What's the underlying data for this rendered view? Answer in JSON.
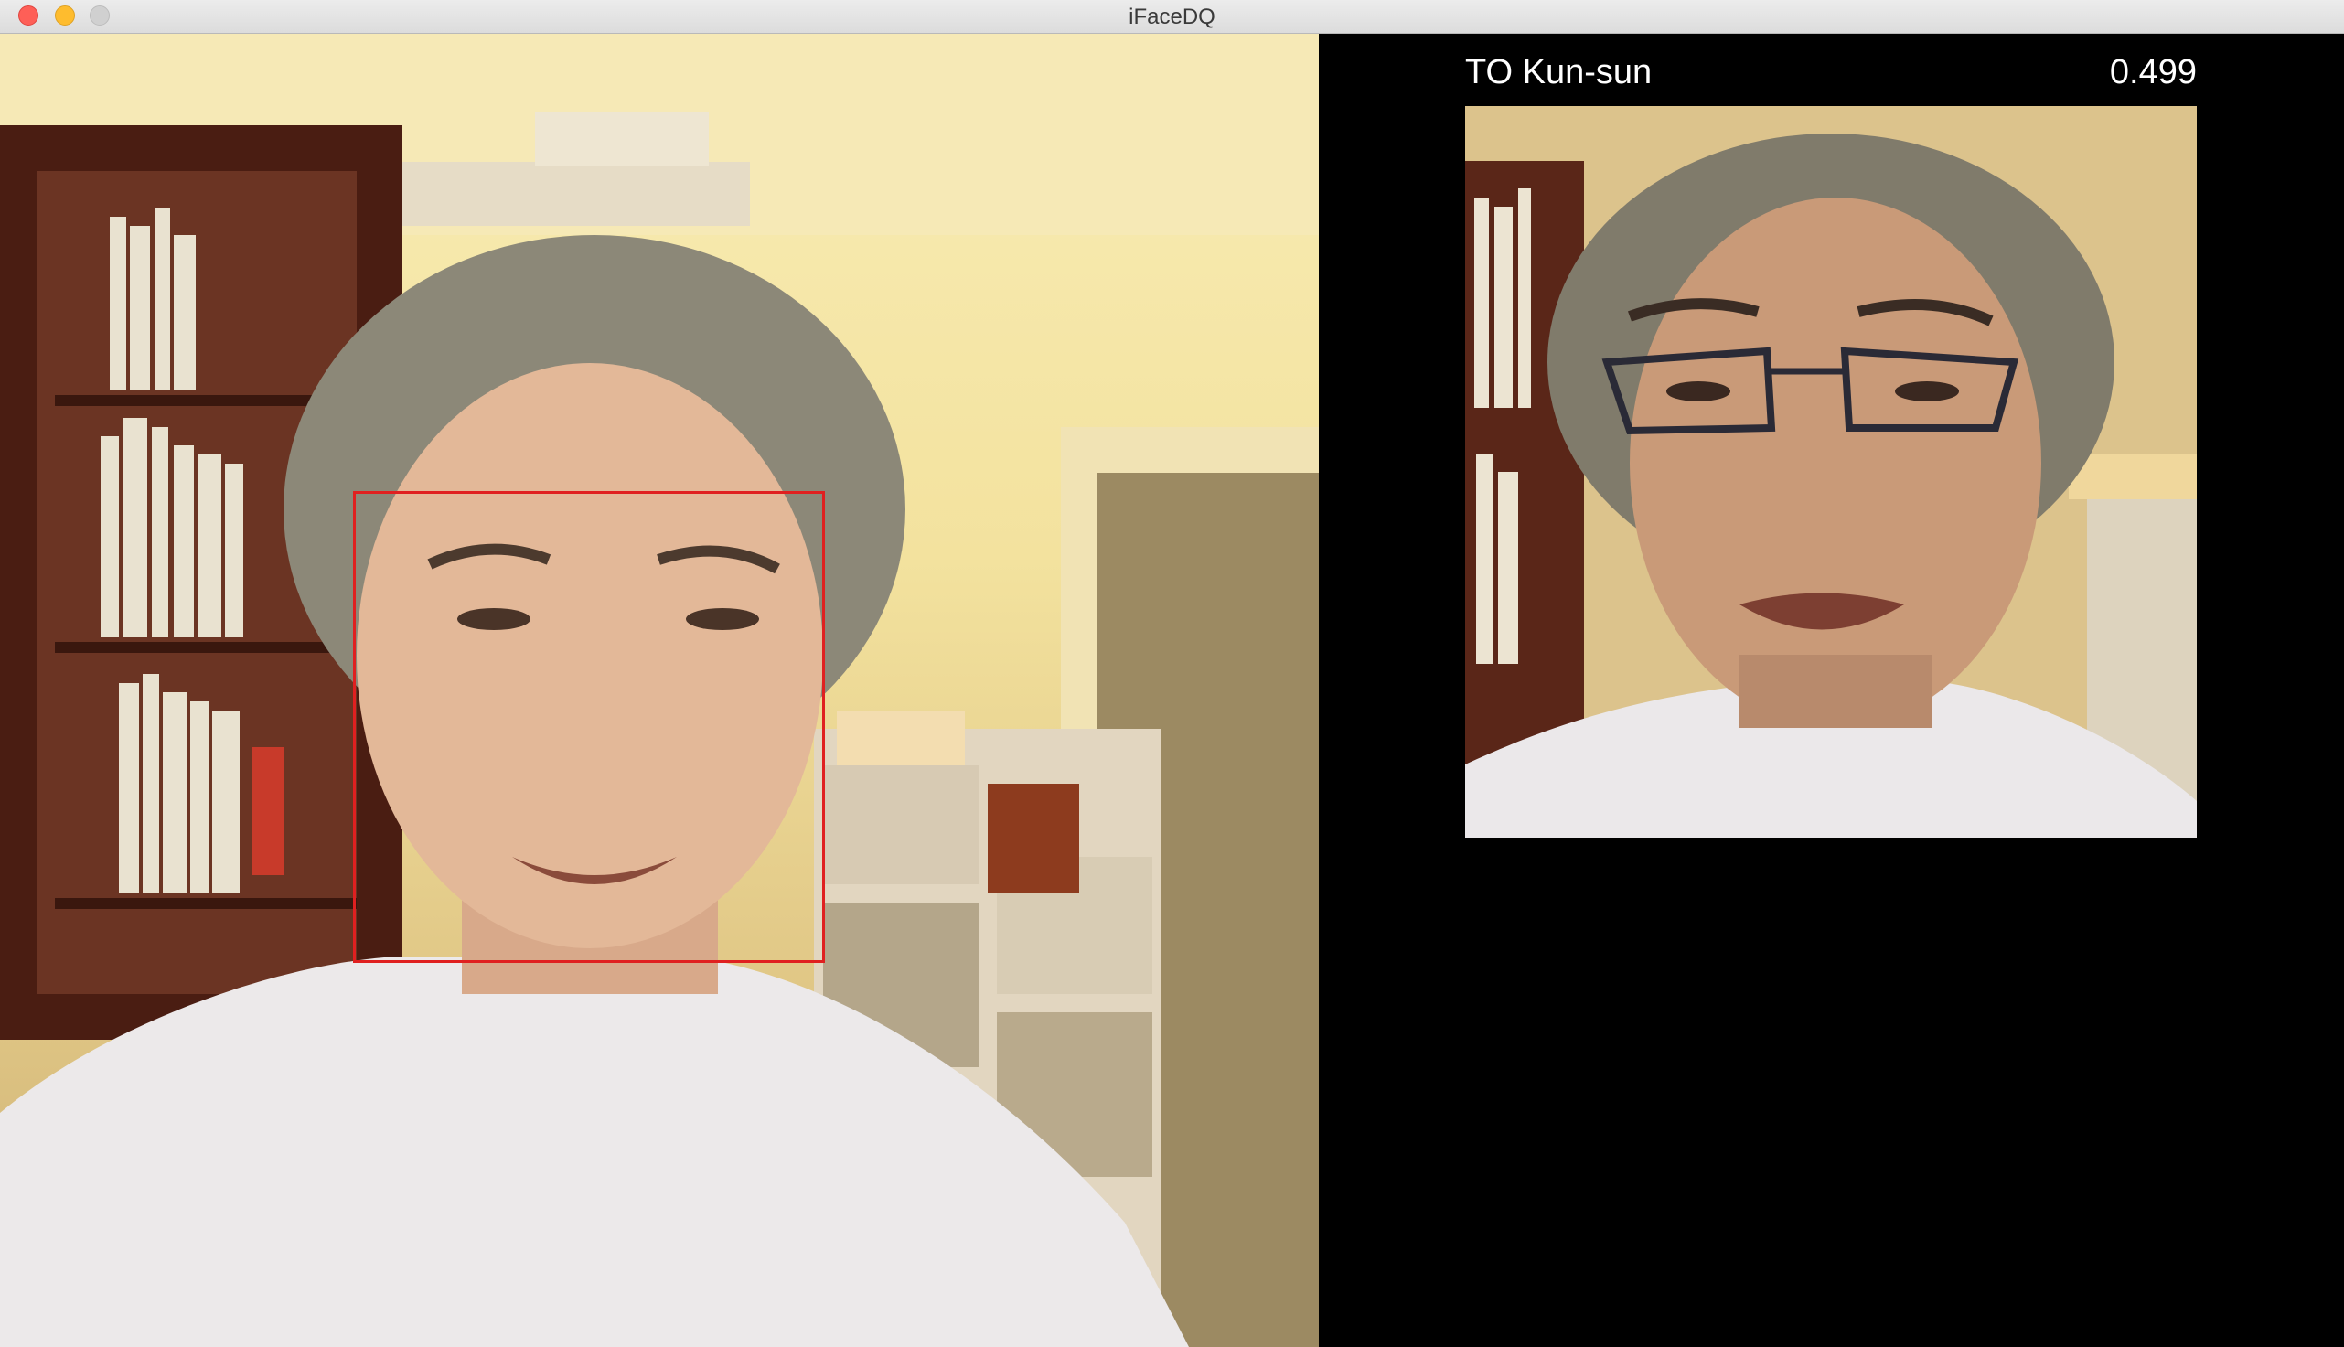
{
  "window": {
    "title": "iFaceDQ"
  },
  "camera_feed": {
    "detection_box_color": "#e02020"
  },
  "match": {
    "name": "TO Kun-sun",
    "score": "0.499"
  },
  "colors": {
    "panel_background": "#000000",
    "text": "#ffffff",
    "close_button": "#fe5f57",
    "minimize_button": "#febc2e",
    "zoom_button": "#d0d0d0"
  }
}
